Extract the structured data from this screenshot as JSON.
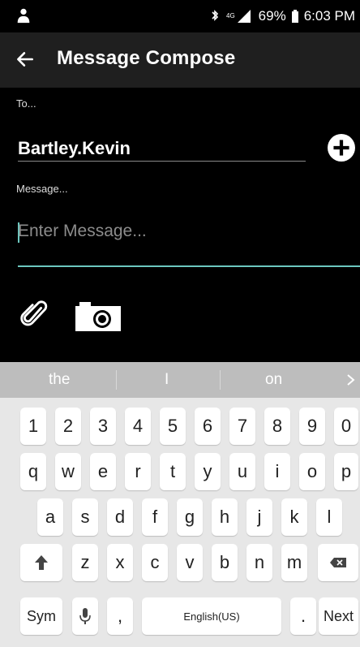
{
  "status_bar": {
    "notification_icon": "person-icon",
    "battery": "69%",
    "time": "6:03 PM",
    "icons": [
      "bluetooth-icon",
      "signal-icon",
      "battery-icon"
    ]
  },
  "app_bar": {
    "back_icon": "arrow-left-icon",
    "title": "Message Compose"
  },
  "compose": {
    "to_label": "To...",
    "to_value": "Bartley.Kevin",
    "add_icon": "plus-circle-icon",
    "message_label": "Message...",
    "message_placeholder": "Enter Message...",
    "attach_icon": "paperclip-icon",
    "camera_icon": "camera-icon",
    "accent_color": "#6cc7bf"
  },
  "keyboard": {
    "suggestions": [
      "the",
      "I",
      "on"
    ],
    "more_icon": "chevron-right-icon",
    "numbers": [
      "1",
      "2",
      "3",
      "4",
      "5",
      "6",
      "7",
      "8",
      "9",
      "0"
    ],
    "row1": [
      "q",
      "w",
      "e",
      "r",
      "t",
      "y",
      "u",
      "i",
      "o",
      "p"
    ],
    "row2": [
      "a",
      "s",
      "d",
      "f",
      "g",
      "h",
      "j",
      "k",
      "l"
    ],
    "row3": [
      "z",
      "x",
      "c",
      "v",
      "b",
      "n",
      "m"
    ],
    "sym": "Sym",
    "space_label": "English(US)",
    "comma": ",",
    "period": ".",
    "next": "Next"
  }
}
